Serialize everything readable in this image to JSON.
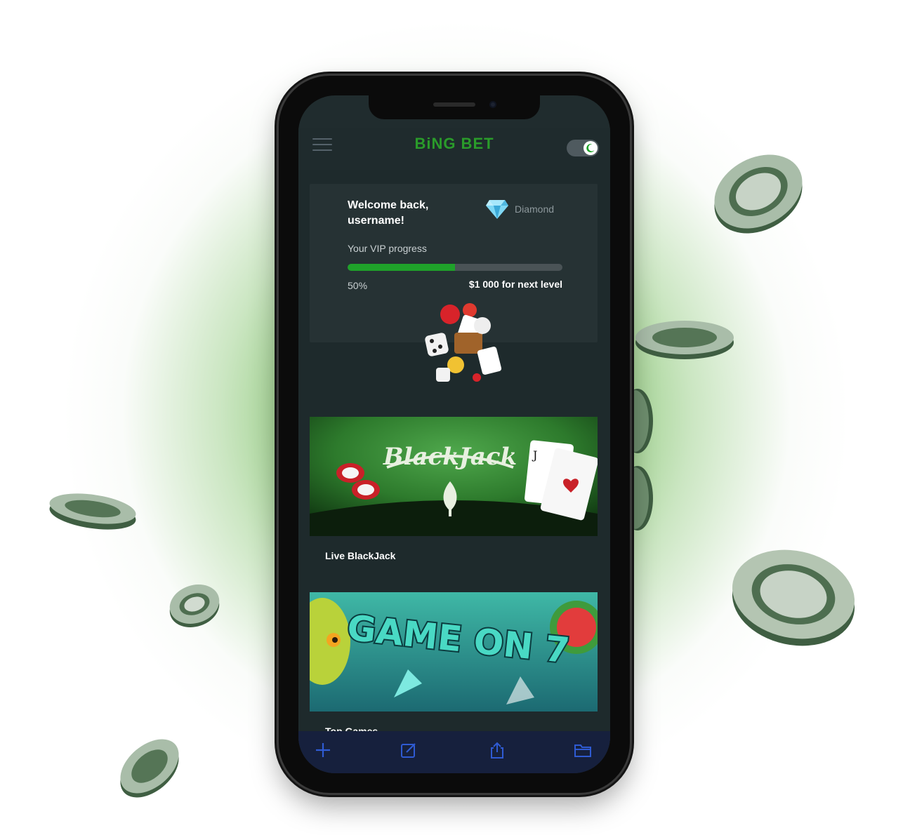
{
  "brand": {
    "logo_text": "BiNG BET",
    "logo_tagline": "",
    "primary_color": "#2a9b2a"
  },
  "header": {
    "menu_icon": "hamburger-menu-icon",
    "theme_toggle_icon": "moon-icon"
  },
  "vip": {
    "welcome_text": "Welcome back, username!",
    "tier_name": "Diamond",
    "tier_icon": "diamond-icon",
    "progress_label": "Your VIP progress",
    "progress_percent_text": "50%",
    "progress_fraction": 0.5,
    "next_level_text": "$1 000 for next level"
  },
  "games": [
    {
      "title": "Live BlackJack",
      "banner": "BlackJack"
    },
    {
      "title": "Top Games",
      "banner": "GAME ON 7"
    }
  ],
  "bottom_bar": {
    "icons": [
      "plus-icon",
      "compose-icon",
      "share-icon",
      "folder-icon"
    ]
  }
}
